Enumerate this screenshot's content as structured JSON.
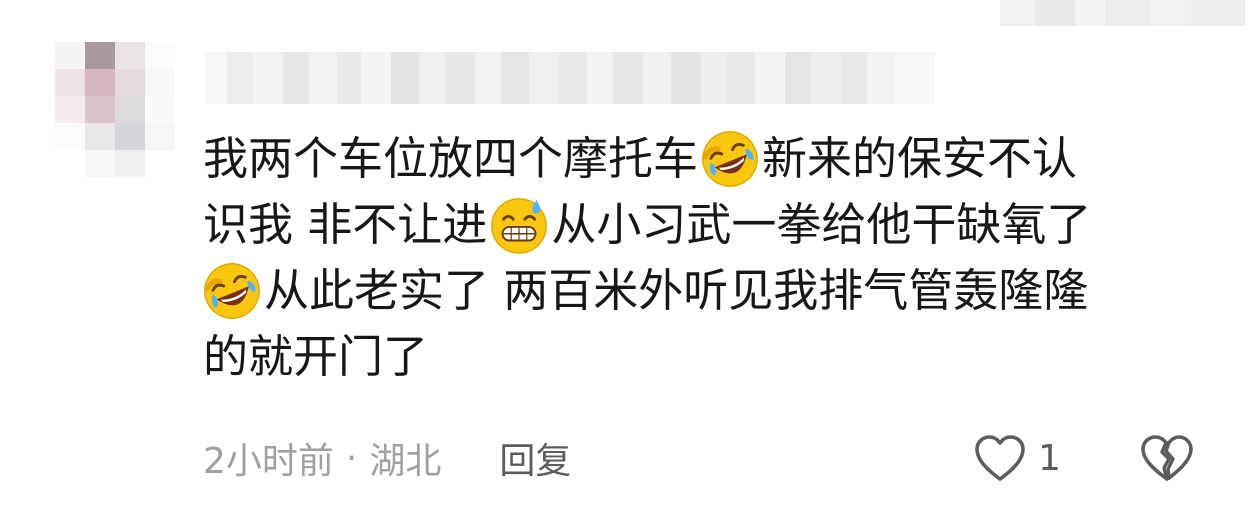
{
  "comment": {
    "lines": [
      {
        "before": "我两个车位放四个摩托车",
        "emoji": "rofl-emoji",
        "after": "新来的保安不认"
      },
      {
        "before": "识我 非不让进",
        "emoji": "grin-sweat-emoji",
        "after": "从小习武一拳给他干缺氧了"
      },
      {
        "before": "",
        "emoji": "rofl-emoji",
        "after": "从此老实了 两百米外听见我排气管轰隆隆"
      },
      {
        "before": "的就开门了",
        "emoji": "",
        "after": ""
      }
    ]
  },
  "meta": {
    "time": "2小时前",
    "separator": "·",
    "location": "湖北",
    "reply_label": "回复"
  },
  "actions": {
    "like_count": "1",
    "like_icon": "heart-outline-icon",
    "dislike_icon": "broken-heart-icon"
  },
  "colors": {
    "text": "#171717",
    "meta": "#a0a0a0",
    "icon": "#5c5c5c",
    "emoji_face": "#f9c80e"
  }
}
